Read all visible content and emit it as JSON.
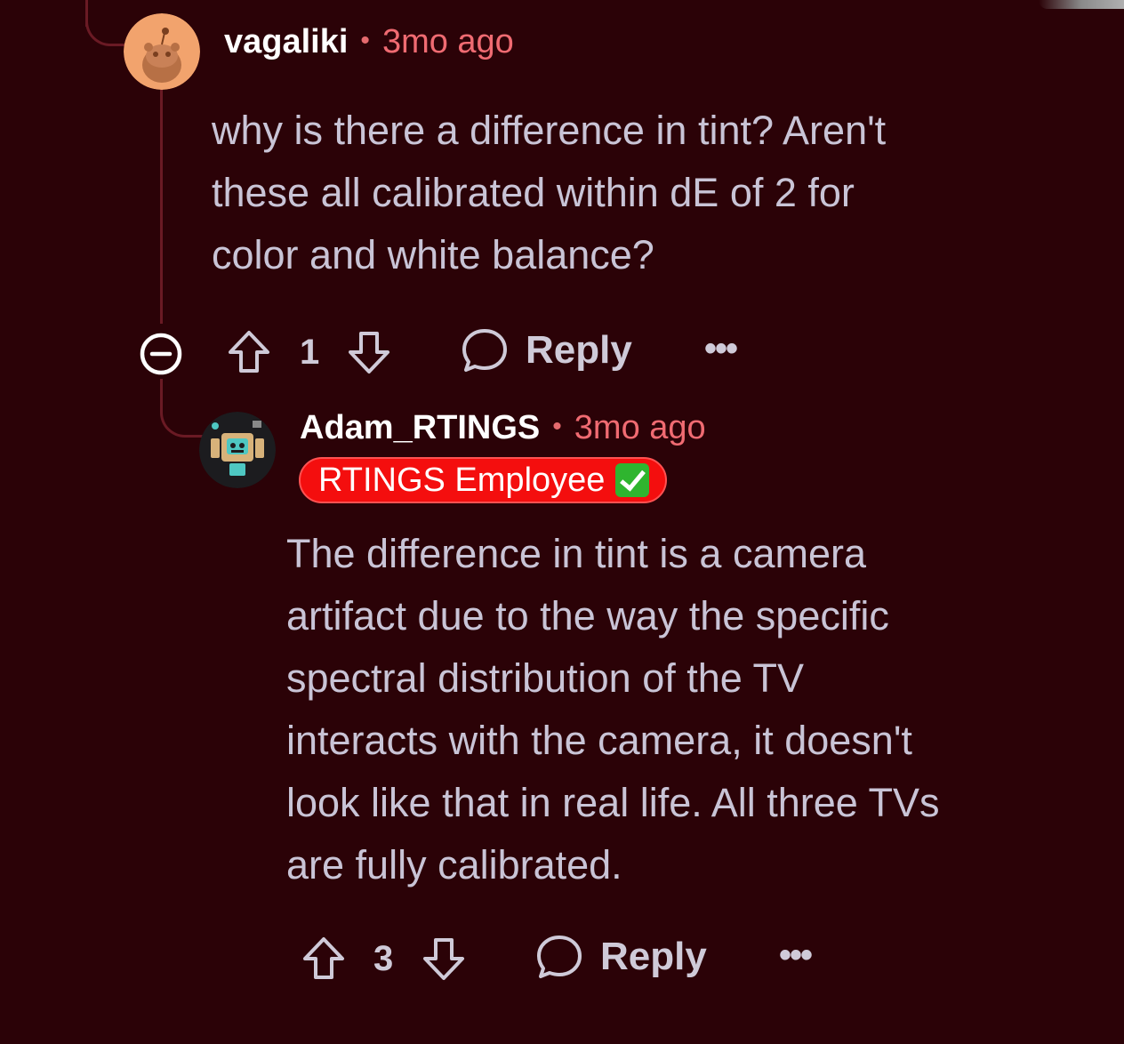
{
  "comments": [
    {
      "username": "vagaliki",
      "separator": "•",
      "timestamp": "3mo ago",
      "body_lines": [
        "why is there a difference in tint? Aren't",
        "these all calibrated within dE of 2 for",
        "color and white balance?"
      ],
      "vote_count": "1",
      "reply_label": "Reply",
      "more_label": "•••"
    },
    {
      "username": "Adam_RTINGS",
      "separator": "•",
      "timestamp": "3mo ago",
      "flair": "RTINGS Employee",
      "body_lines": [
        "The difference in tint is a camera",
        "artifact due to the way the specific",
        "spectral distribution of the TV",
        "interacts with the camera, it doesn't",
        "look like that in real life. All three TVs",
        "are fully calibrated."
      ],
      "vote_count": "3",
      "reply_label": "Reply",
      "more_label": "•••"
    }
  ],
  "colors": {
    "background": "#2b0207",
    "username": "#ffffff",
    "timestamp": "#f06b72",
    "body_text": "#c9c4d6",
    "thread_line": "#6a1a24",
    "flair_bg": "#f40e0e",
    "flair_check": "#2fb52f"
  },
  "icons": {
    "collapse": "minus-circle-icon",
    "upvote": "arrow-up-outline-icon",
    "downvote": "arrow-down-outline-icon",
    "reply": "speech-bubble-icon",
    "more": "ellipsis-icon"
  }
}
